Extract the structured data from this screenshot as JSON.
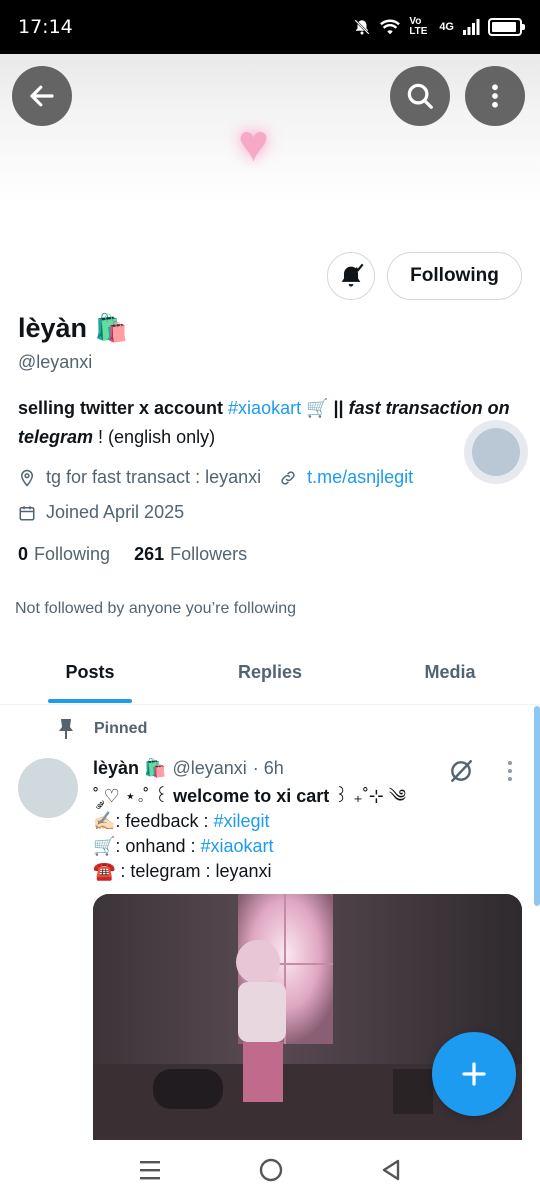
{
  "status_bar": {
    "time": "17:14",
    "network": "4G",
    "volte": "Vo LTE"
  },
  "top_bar": {
    "back_icon": "arrow-left-icon",
    "search_icon": "search-icon",
    "more_icon": "more-vertical-icon"
  },
  "banner": {
    "heart_glyph": "♥",
    "colors": {
      "heart": "#f6a8c7"
    }
  },
  "profile": {
    "name": "lèyàn 🛍️",
    "handle": "@leyanxi",
    "following_button": "Following",
    "bio": {
      "part1": "selling twitter x account ",
      "hashtag": "#xiaokart",
      "part2": " 🛒 || ",
      "part3": "fast transaction on telegram",
      "part4": " ! (english only)"
    },
    "location": "tg for fast transact : leyanxi",
    "website": "t.me/asnjlegit",
    "joined": "Joined April 2025",
    "following_count": "0",
    "following_label": "Following",
    "followers_count": "261",
    "followers_label": "Followers",
    "not_followed": "Not followed by anyone you’re following"
  },
  "tabs": [
    {
      "label": "Posts",
      "active": true
    },
    {
      "label": "Replies",
      "active": false
    },
    {
      "label": "Media",
      "active": false
    }
  ],
  "pinned_tweet": {
    "pinned_label": "Pinned",
    "author_name": "lèyàn 🛍️",
    "author_handle": "@leyanxi",
    "time": "· 6h",
    "line1_prefix": "˚ ༘♡ ⋆｡˚ ꒰ ",
    "line1_bold": "welcome to xi cart",
    "line1_suffix": " ꒱ ₊˚⊹ ༄",
    "line2_prefix": "✍🏻: feedback : ",
    "line2_tag": "#xilegit",
    "line3_prefix": "🛒: onhand : ",
    "line3_tag": "#xiaokart",
    "line4": "☎️ : telegram : leyanxi"
  },
  "accent_color": "#1d9bf0"
}
